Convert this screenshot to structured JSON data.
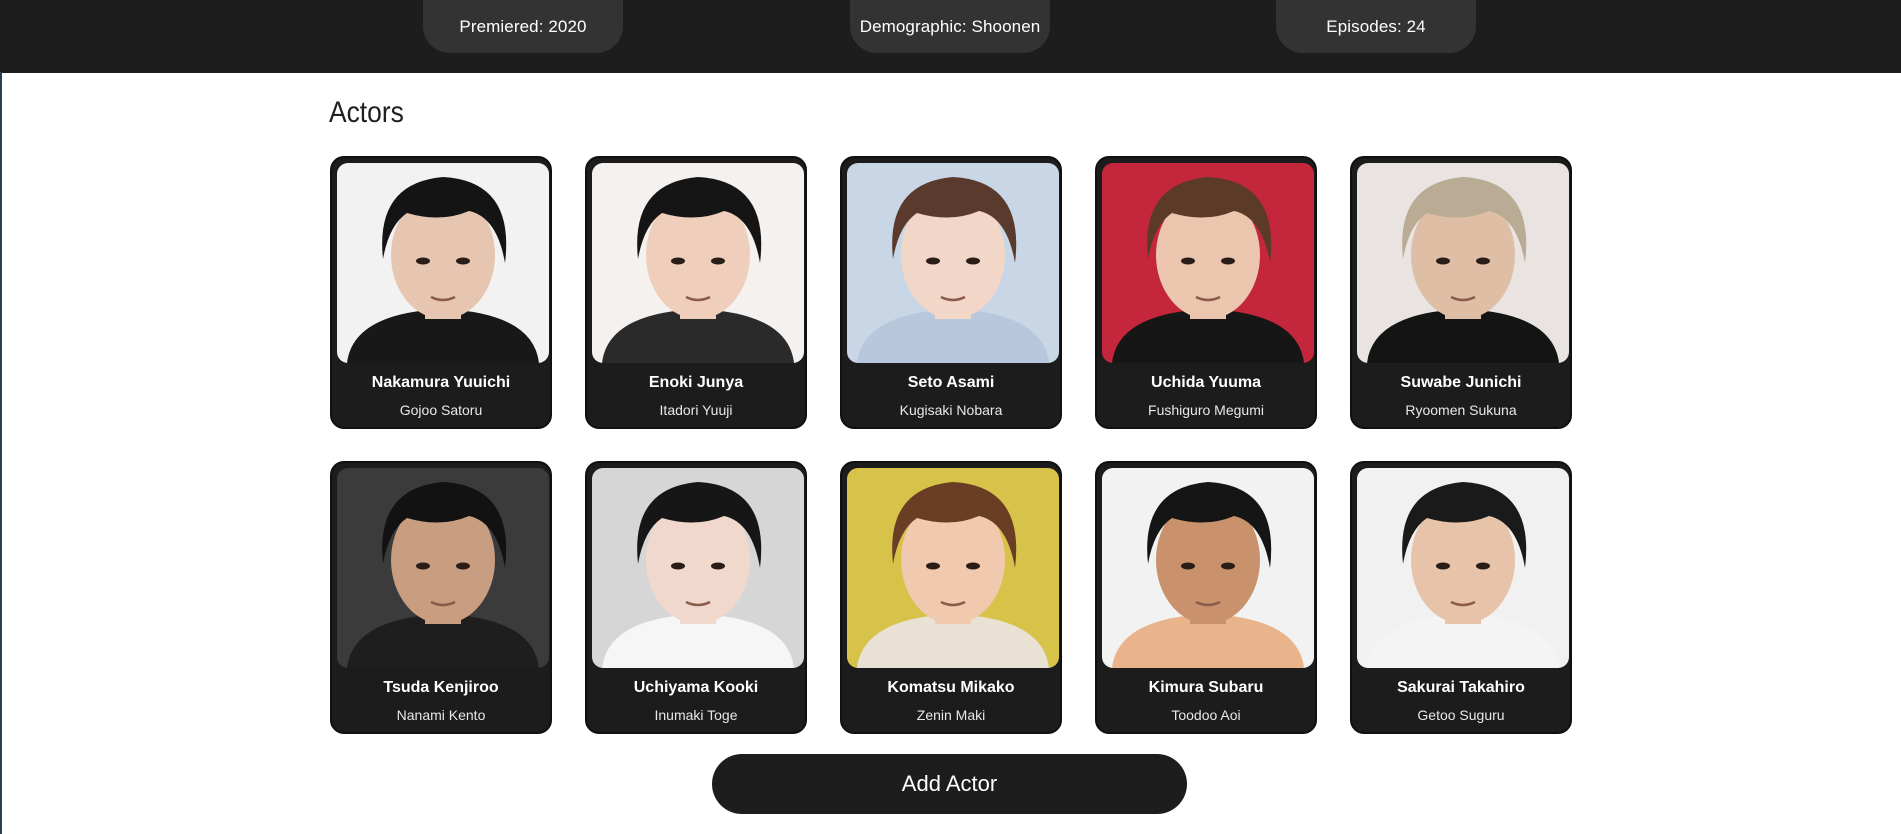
{
  "info_pills": [
    {
      "label": "Premiered: 2020"
    },
    {
      "label": "Demographic: Shoonen"
    },
    {
      "label": "Episodes: 24"
    }
  ],
  "section_title": "Actors",
  "actors": [
    {
      "name": "Nakamura Yuuichi",
      "role": "Gojoo Satoru",
      "bg": "#f2f2f2",
      "hair": "#141414",
      "skin": "#e6c6b0",
      "shirt": "#181818"
    },
    {
      "name": "Enoki Junya",
      "role": "Itadori Yuuji",
      "bg": "#f4f1ef",
      "hair": "#151515",
      "skin": "#efcfbb",
      "shirt": "#2a2a2a"
    },
    {
      "name": "Seto Asami",
      "role": "Kugisaki Nobara",
      "bg": "#c9d6e6",
      "hair": "#5a3a2c",
      "skin": "#f2d6c8",
      "shirt": "#b7c7dc"
    },
    {
      "name": "Uchida Yuuma",
      "role": "Fushiguro Megumi",
      "bg": "#c4263b",
      "hair": "#5b3b28",
      "skin": "#ebc5ad",
      "shirt": "#161616"
    },
    {
      "name": "Suwabe Junichi",
      "role": "Ryoomen Sukuna",
      "bg": "#e9e4e2",
      "hair": "#b9ab94",
      "skin": "#dfbea6",
      "shirt": "#141414"
    },
    {
      "name": "Tsuda Kenjiroo",
      "role": "Nanami Kento",
      "bg": "#3b3b3b",
      "hair": "#121212",
      "skin": "#c99d80",
      "shirt": "#1e1e1e"
    },
    {
      "name": "Uchiyama Kooki",
      "role": "Inumaki Toge",
      "bg": "#d6d6d6",
      "hair": "#161616",
      "skin": "#f0d8cc",
      "shirt": "#f6f6f6"
    },
    {
      "name": "Komatsu Mikako",
      "role": "Zenin Maki",
      "bg": "#d7c24a",
      "hair": "#6a3e24",
      "skin": "#f0c9ae",
      "shirt": "#e9e1d3"
    },
    {
      "name": "Kimura Subaru",
      "role": "Toodoo Aoi",
      "bg": "#f2f2f2",
      "hair": "#151515",
      "skin": "#c9926c",
      "shirt": "#e9b48c"
    },
    {
      "name": "Sakurai Takahiro",
      "role": "Getoo Suguru",
      "bg": "#f1f1f1",
      "hair": "#1a1a1a",
      "skin": "#e7c3a9",
      "shirt": "#f4f4f4"
    }
  ],
  "add_button": "Add Actor"
}
